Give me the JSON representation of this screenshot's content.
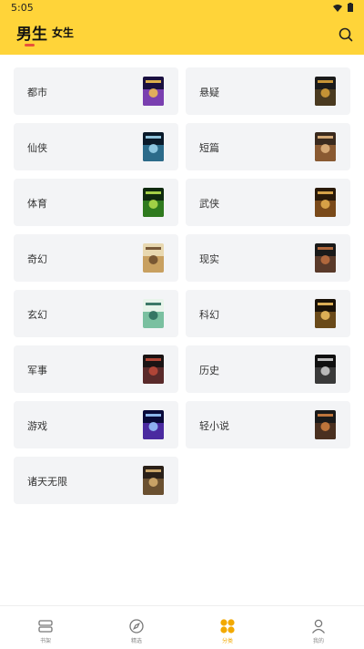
{
  "status_bar": {
    "time": "5:05"
  },
  "header": {
    "tabs": [
      {
        "label": "男生",
        "active": true
      },
      {
        "label": "女生",
        "active": false
      }
    ],
    "search_icon": "search-icon"
  },
  "categories": [
    {
      "label": "都市",
      "cover_colors": [
        "#1a1040",
        "#7a3fb0",
        "#f2c14e"
      ]
    },
    {
      "label": "悬疑",
      "cover_colors": [
        "#1b1b1b",
        "#4a3a20",
        "#d9a23a"
      ]
    },
    {
      "label": "仙侠",
      "cover_colors": [
        "#0a1a2a",
        "#2c6b8a",
        "#9fd6ee"
      ]
    },
    {
      "label": "短篇",
      "cover_colors": [
        "#3a2a1e",
        "#8a5a32",
        "#e3b680"
      ]
    },
    {
      "label": "体育",
      "cover_colors": [
        "#0f2a0f",
        "#2f7a1e",
        "#b4e04c"
      ]
    },
    {
      "label": "武侠",
      "cover_colors": [
        "#2a1a0a",
        "#7a4a1a",
        "#e7b050"
      ]
    },
    {
      "label": "奇幻",
      "cover_colors": [
        "#e8d8b0",
        "#c8a060",
        "#6a4a2a"
      ]
    },
    {
      "label": "现实",
      "cover_colors": [
        "#1a1a1a",
        "#5a3a2a",
        "#c07040"
      ]
    },
    {
      "label": "玄幻",
      "cover_colors": [
        "#e8f4ea",
        "#7ac0a0",
        "#2a6a5a"
      ]
    },
    {
      "label": "科幻",
      "cover_colors": [
        "#1a1208",
        "#6a4a1a",
        "#f0c060"
      ]
    },
    {
      "label": "军事",
      "cover_colors": [
        "#1a1414",
        "#5a2a2a",
        "#c04a3a"
      ]
    },
    {
      "label": "历史",
      "cover_colors": [
        "#101010",
        "#3a3a3a",
        "#d0d0d0"
      ]
    },
    {
      "label": "游戏",
      "cover_colors": [
        "#0a0a3a",
        "#4a2aa0",
        "#9ac8ff"
      ]
    },
    {
      "label": "轻小说",
      "cover_colors": [
        "#1a1a1a",
        "#4a3020",
        "#d08040"
      ]
    },
    {
      "label": "诸天无限",
      "cover_colors": [
        "#2a2018",
        "#6a5030",
        "#d8b070"
      ]
    }
  ],
  "bottom_nav": [
    {
      "label": "书架",
      "icon": "bookshelf-icon",
      "active": false
    },
    {
      "label": "精选",
      "icon": "compass-icon",
      "active": false
    },
    {
      "label": "分类",
      "icon": "category-grid-icon",
      "active": true
    },
    {
      "label": "我的",
      "icon": "profile-icon",
      "active": false
    }
  ],
  "colors": {
    "header_bg": "#ffd439",
    "tab_underline": "#e8523a",
    "active_nav": "#f2a900",
    "card_bg": "#f3f4f6"
  }
}
